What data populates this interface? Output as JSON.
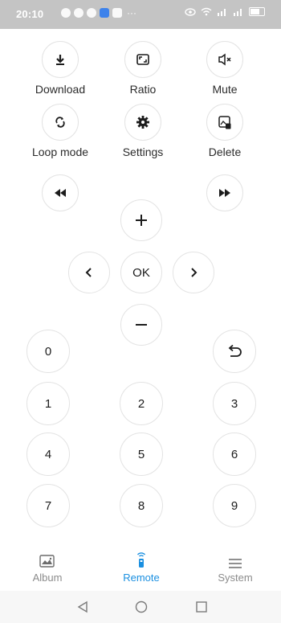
{
  "status_bar": {
    "time": "20:10",
    "dots": "···"
  },
  "controls": {
    "download_label": "Download",
    "ratio_label": "Ratio",
    "mute_label": "Mute",
    "loop_label": "Loop mode",
    "settings_label": "Settings",
    "delete_label": "Delete"
  },
  "dpad": {
    "plus": "+",
    "minus": "−",
    "left": "‹",
    "right": "›",
    "ok": "OK"
  },
  "keypad": {
    "digits": [
      "0",
      "1",
      "2",
      "3",
      "4",
      "5",
      "6",
      "7",
      "8",
      "9"
    ]
  },
  "bottom_nav": {
    "album": "Album",
    "remote": "Remote",
    "system": "System",
    "active": "remote"
  },
  "colors": {
    "accent": "#1a8fe0",
    "border": "#e3e3e3",
    "status_bar": "#c4c4c4"
  },
  "icons": [
    "download-icon",
    "ratio-icon",
    "mute-icon",
    "loop-icon",
    "gear-icon",
    "delete-icon",
    "rewind-icon",
    "fast-forward-icon",
    "back-icon",
    "album-icon",
    "remote-icon",
    "menu-icon"
  ]
}
